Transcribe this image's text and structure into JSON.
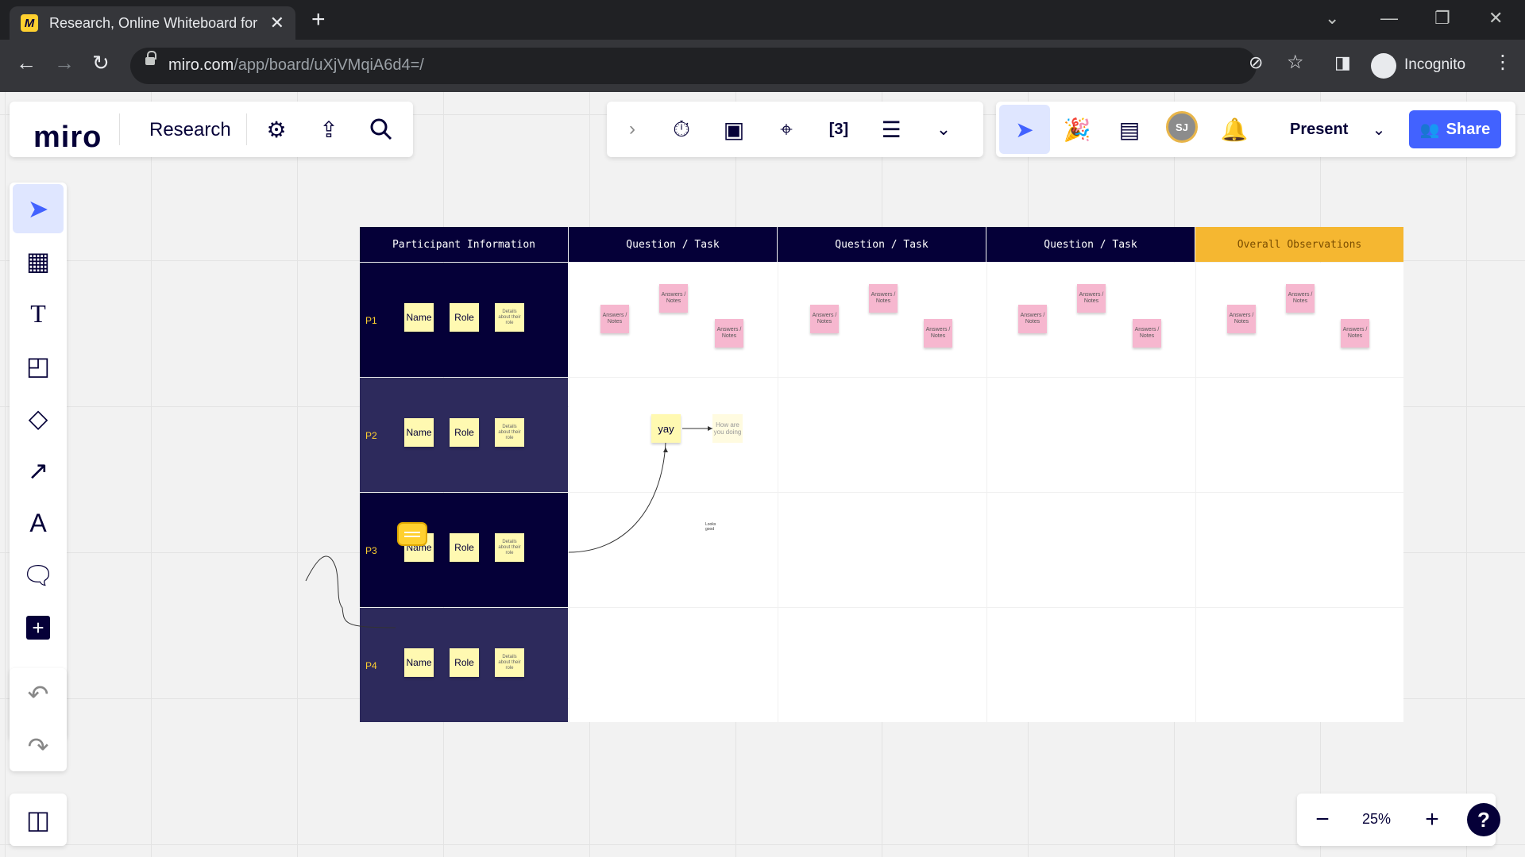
{
  "browser": {
    "tab_title": "Research, Online Whiteboard for",
    "url_host": "miro.com",
    "url_path": "/app/board/uXjVMqiA6d4=/",
    "incognito_label": "Incognito"
  },
  "header": {
    "logo": "miro",
    "board_name": "Research",
    "present_label": "Present",
    "share_label": "Share",
    "avatar_initials": "SJ"
  },
  "board": {
    "headers": [
      "Participant Information",
      "Question / Task",
      "Question / Task",
      "Question / Task",
      "Overall Observations"
    ],
    "rows": [
      {
        "label": "P1"
      },
      {
        "label": "P2"
      },
      {
        "label": "P3"
      },
      {
        "label": "P4"
      }
    ],
    "sticky_name": "Name",
    "sticky_role": "Role",
    "sticky_details": "Details about their role",
    "answers_note": "Answers / Notes",
    "yay_note": "yay",
    "how_note": "How are you doing",
    "looks_good": "Looks good"
  },
  "zoom": {
    "level": "25%"
  },
  "colors": {
    "brand_yellow": "#ffd02f",
    "header_dark": "#050038",
    "row_alt": "#2d2a5c",
    "accent_blue": "#4262ff",
    "sticky_yellow": "#fff9b1",
    "sticky_pink": "#f6b7cf",
    "observations_header": "#f5b731"
  }
}
